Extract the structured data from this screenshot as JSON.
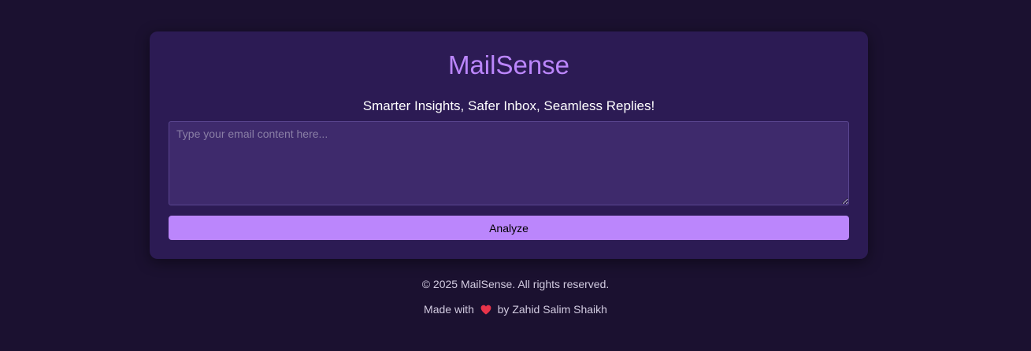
{
  "app": {
    "title": "MailSense",
    "tagline": "Smarter Insights, Safer Inbox, Seamless Replies!"
  },
  "email_input": {
    "placeholder": "Type your email content here...",
    "value": ""
  },
  "analyze_button": {
    "label": "Analyze"
  },
  "footer": {
    "copyright": "© 2025 MailSense. All rights reserved.",
    "made_with_prefix": "Made with",
    "made_with_icon": "heart-icon",
    "made_with_suffix": "by Zahid Salim Shaikh"
  },
  "colors": {
    "page_background": "#1b1130",
    "card_background": "#2c1b54",
    "accent": "#bb86fc",
    "input_background": "#3e2a6c",
    "heart": "#e8344a"
  }
}
